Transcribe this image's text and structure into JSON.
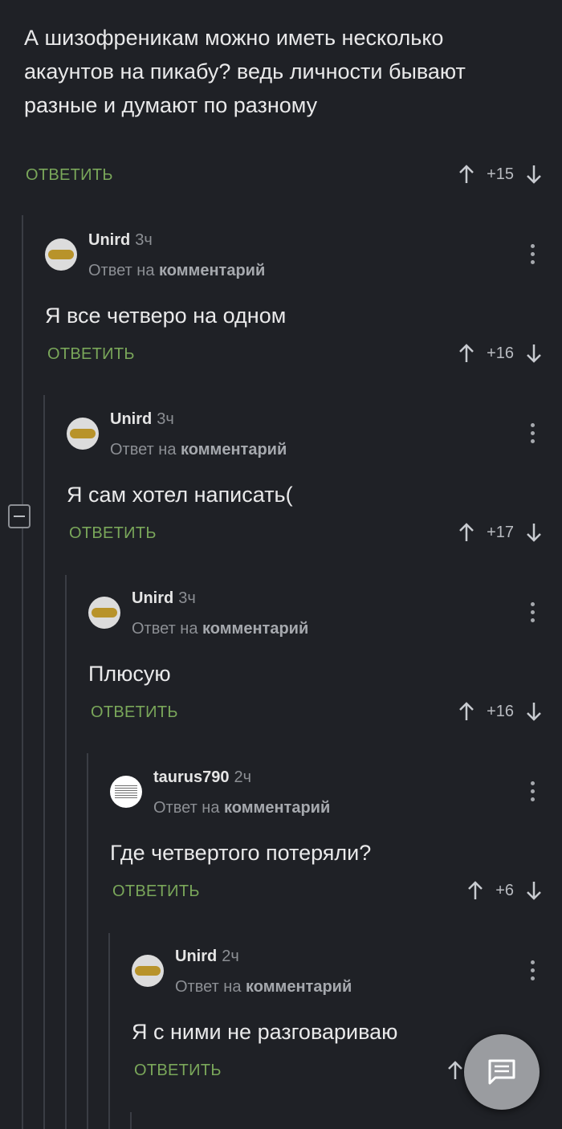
{
  "root": {
    "text": "А шизофреникам можно иметь несколько акаунтов на пикабу? ведь личности бывают разные и думают по разному",
    "reply_label": "ОТВЕТИТЬ",
    "score": "+15"
  },
  "comments": [
    {
      "author": "Unird",
      "time": "3ч",
      "reply_prefix": "Ответ на",
      "reply_target": "комментарий",
      "text": "Я все четверо на одном",
      "reply_label": "ОТВЕТИТЬ",
      "score": "+16"
    },
    {
      "author": "Unird",
      "time": "3ч",
      "reply_prefix": "Ответ на",
      "reply_target": "комментарий",
      "text": "Я сам хотел написать(",
      "reply_label": "ОТВЕТИТЬ",
      "score": "+17"
    },
    {
      "author": "Unird",
      "time": "3ч",
      "reply_prefix": "Ответ на",
      "reply_target": "комментарий",
      "text": "Плюсую",
      "reply_label": "ОТВЕТИТЬ",
      "score": "+16"
    },
    {
      "author": "taurus790",
      "time": "2ч",
      "reply_prefix": "Ответ на",
      "reply_target": "комментарий",
      "text": "Где четвертого потеряли?",
      "reply_label": "ОТВЕТИТЬ",
      "score": "+6"
    },
    {
      "author": "Unird",
      "time": "2ч",
      "reply_prefix": "Ответ на",
      "reply_target": "комментарий",
      "text": "Я с ними не разговариваю",
      "reply_label": "ОТВЕТИТЬ",
      "score": ""
    }
  ],
  "icons": {
    "upvote": "arrow-up-icon",
    "downvote": "arrow-down-icon",
    "menu": "kebab-menu-icon",
    "collapse": "collapse-icon",
    "fab": "comment-icon"
  },
  "colors": {
    "background": "#1f2126",
    "reply_green": "#7aa75a",
    "muted": "#8c8f94"
  }
}
